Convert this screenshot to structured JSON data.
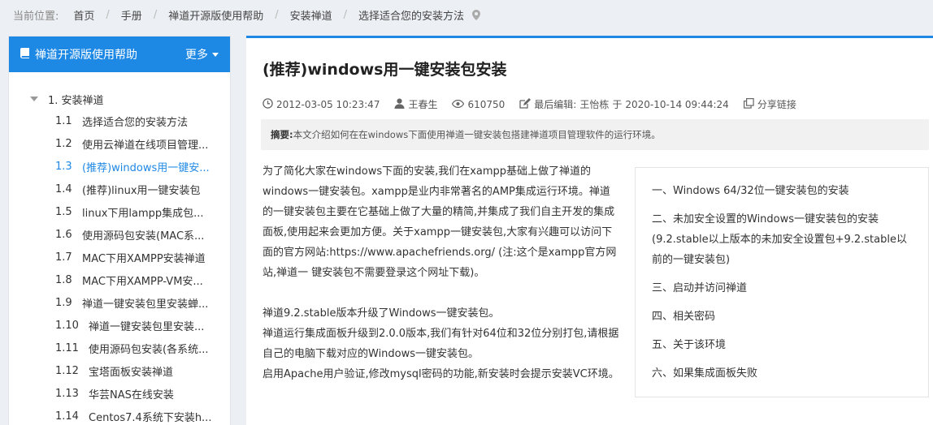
{
  "breadcrumb": {
    "label": "当前位置:",
    "items": [
      "首页",
      "手册",
      "禅道开源版使用帮助",
      "安装禅道",
      "选择适合您的安装方法"
    ]
  },
  "sidebar": {
    "title": "禅道开源版使用帮助",
    "more_label": "更多",
    "parent": "1.  安装禅道",
    "items": [
      {
        "no": "1.1",
        "label": "选择适合您的安装方法"
      },
      {
        "no": "1.2",
        "label": "使用云禅道在线项目管理..."
      },
      {
        "no": "1.3",
        "label": "(推荐)windows用一键安..."
      },
      {
        "no": "1.4",
        "label": "(推荐)linux用一键安装包"
      },
      {
        "no": "1.5",
        "label": "linux下用lampp集成包..."
      },
      {
        "no": "1.6",
        "label": "使用源码包安装(MAC系..."
      },
      {
        "no": "1.7",
        "label": "MAC下用XAMPP安装禅道"
      },
      {
        "no": "1.8",
        "label": "MAC下用XAMPP-VM安..."
      },
      {
        "no": "1.9",
        "label": "禅道一键安装包里安装蝉..."
      },
      {
        "no": "1.10",
        "label": "禅道一键安装包里安装..."
      },
      {
        "no": "1.11",
        "label": "使用源码包安装(各系统..."
      },
      {
        "no": "1.12",
        "label": "宝塔面板安装禅道"
      },
      {
        "no": "1.13",
        "label": "华芸NAS在线安装"
      },
      {
        "no": "1.14",
        "label": "Centos7.4系统下安装h..."
      }
    ]
  },
  "article": {
    "title": "(推荐)windows用一键安装包安装",
    "date": "2012-03-05 10:23:47",
    "author": "王春生",
    "views": "610750",
    "edit_label": "最后编辑:",
    "editor": "王怡栋",
    "edit_mid": "于",
    "edit_time": "2020-10-14 09:44:24",
    "share": "分享链接",
    "abstract_label": "摘要:",
    "abstract": "本文介绍如何在在windows下面使用禅道一键安装包搭建禅道项目管理软件的运行环境。",
    "paragraphs": [
      "为了简化大家在windows下面的安装,我们在xampp基础上做了禅道的windows一键安装包。xampp是业内非常著名的AMP集成运行环境。禅道的一键安装包主要在它基础上做了大量的精简,并集成了我们自主开发的集成面板,使用起来会更加方便。关于xampp一键安装包,大家有兴趣可以访问下面的官方网站:https://www.apachefriends.org/ (注:这个是xampp官方网站,禅道一 键安装包不需要登录这个网址下载)。",
      "禅道9.2.stable版本升级了Windows一键安装包。",
      "禅道运行集成面板升级到2.0.0版本,我们有针对64位和32位分别打包,请根据自己的电脑下载对应的Windows一键安装包。",
      "启用Apache用户验证,修改mysql密码的功能,新安装时会提示安装VC环境。"
    ]
  },
  "toc": [
    "一、Windows 64/32位一键安装包的安装",
    "二、未加安全设置的Windows一键安装包的安装(9.2.stable以上版本的未加安全设置包+9.2.stable以前的一键安装包)",
    "三、启动并访问禅道",
    "四、相关密码",
    "五、关于该环境",
    "六、如果集成面板失败"
  ],
  "colors": {
    "accent": "#1e88e5",
    "background": "#eceff3"
  }
}
